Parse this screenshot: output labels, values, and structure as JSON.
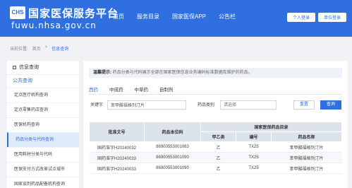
{
  "header": {
    "logo_text": "CHS",
    "site_title": "国家医保服务平台",
    "site_url": "fuwu.nhsa.gov.cn",
    "nav": [
      "首页",
      "服务目录",
      "国家医保APP",
      "公告栏"
    ],
    "personal_login": "个人登录",
    "unit_login": "单位登录"
  },
  "breadcrumb": {
    "prefix": "当前位置:",
    "home": "首页",
    "sep": ">",
    "current": "信息查询"
  },
  "sidebar": {
    "title": "信息查询",
    "section": "公共查询",
    "items": [
      "定点医疗机构查询",
      "定点零售药店查询",
      "医保机构查询",
      "药品分类与代码查询",
      "医用耗材分类与代码",
      "医保支付方式改革试点城市",
      "国家谈判药品配备机构查询"
    ]
  },
  "main": {
    "notice_label": "温馨提示:",
    "notice_text": "药品分类与代码展示全部在国家医保信息业务编码标准数据库维护的药品。",
    "tabs": [
      "西药",
      "中成药",
      "中草药",
      "自制剂"
    ],
    "keyword_label": "关键字",
    "keyword_value": "苯甲酸福格列汀片",
    "category_label": "药品类别",
    "category_placeholder": "请选择",
    "reset_label": "重置",
    "query_label": "查询",
    "table": {
      "col_approval": "批准文号",
      "col_code": "药品本位码",
      "group_header": "国家医保药品目录",
      "col_class": "甲乙类",
      "col_no": "编号",
      "col_name": "药品名称",
      "rows": [
        [
          "国药准字H20240032",
          "86900553001083",
          "乙",
          "TX25",
          "苯甲酸福格列汀片"
        ],
        [
          "国药准字H20240033",
          "86900553001090",
          "乙",
          "TX25",
          "苯甲酸福格列汀片"
        ],
        [
          "国药准字H20240033",
          "86900553001090",
          "乙",
          "TX25",
          "苯甲酸福格列汀片"
        ]
      ]
    }
  }
}
